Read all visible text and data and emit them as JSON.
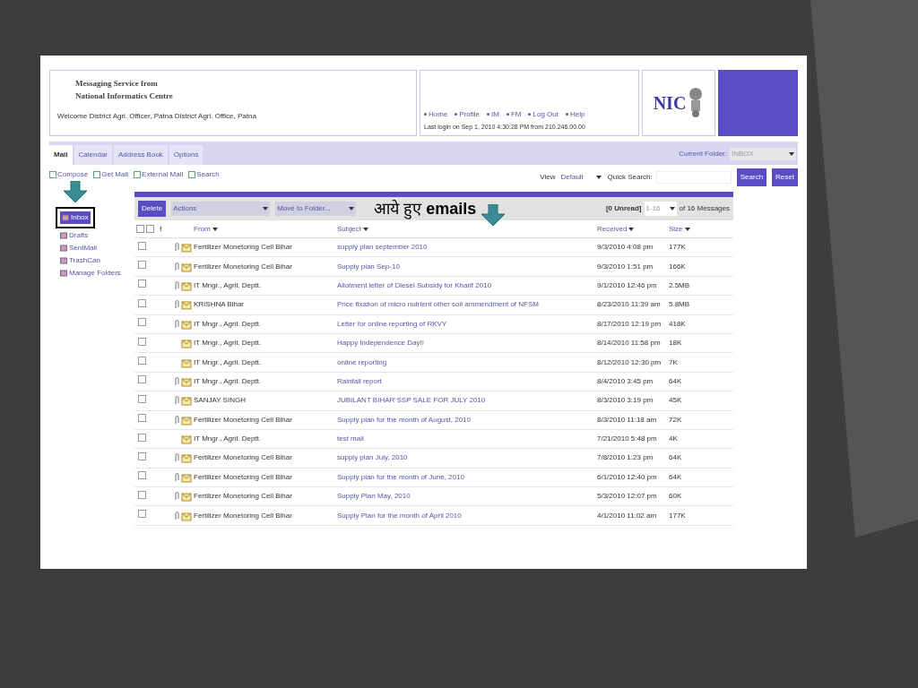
{
  "header": {
    "title_lines": [
      "Messaging Service from",
      "National Informatics Centre"
    ],
    "welcome": "Welcome District Agri. Officer, Patna District Agri. Office, Patna",
    "links": [
      "Home",
      "Profile",
      "IM",
      "FM",
      "Log Out",
      "Help"
    ],
    "last_login": "Last login on Sep 1, 2010 4:30:28 PM from 210.246.00.00",
    "logo": "NIC"
  },
  "tabs": [
    {
      "label": "Mail",
      "selected": true
    },
    {
      "label": "Calendar",
      "selected": false
    },
    {
      "label": "Address Book",
      "selected": false
    },
    {
      "label": "Options",
      "selected": false
    }
  ],
  "current_folder": {
    "label": "Current Folder:",
    "value": "INBOX"
  },
  "toolbar": [
    "Compose",
    "Get Mail",
    "External Mail",
    "Search"
  ],
  "view": {
    "label": "View",
    "value": "Default",
    "search_label": "Quick Search:",
    "buttons": [
      "Search",
      "Reset"
    ]
  },
  "folders": [
    {
      "label": "Inbox",
      "selected": true
    },
    {
      "label": "Drafts",
      "selected": false
    },
    {
      "label": "SentMail",
      "selected": false
    },
    {
      "label": "TrashCan",
      "selected": false
    },
    {
      "label": "Manage Folders",
      "selected": false
    }
  ],
  "actions": {
    "delete": "Delete",
    "actions": "Actions",
    "move": "Move to Folder...",
    "unread": "[0 Unread]",
    "range": "1-16",
    "total": "of 16 Messages"
  },
  "annotation": "आये हुए **emails**",
  "columns": [
    "!",
    "From",
    "Subject",
    "Received",
    "Size"
  ],
  "header_checkboxes": [
    {
      "checked": false
    },
    {
      "checked": false
    }
  ],
  "messages": [
    {
      "from": "Fertilizer Monetoring Cell Bihar",
      "subject": "supply plan september 2010",
      "received": "9/3/2010 4:08 pm",
      "size": "177K",
      "attachment": true,
      "checked": false
    },
    {
      "from": "Fertilizer Monetoring Cell Bihar",
      "subject": "Supply plan Sep-10",
      "received": "9/3/2010 1:51 pm",
      "size": "166K",
      "attachment": true,
      "checked": false
    },
    {
      "from": "IT Mngr., Agril. Deptt.",
      "subject": "Allotment letter of Diesel Subsidy for Kharif 2010",
      "received": "9/1/2010 12:46 pm",
      "size": "2.5MB",
      "attachment": true,
      "checked": false
    },
    {
      "from": "KRISHNA Bihar",
      "subject": "Price fixation of micro nutrient other soil ammendment of NFSM",
      "received": "8/23/2010 11:39 am",
      "size": "5.8MB",
      "attachment": true,
      "checked": false
    },
    {
      "from": "IT Mngr., Agril. Deptt.",
      "subject": "Letter for online reporting of RKVY",
      "received": "8/17/2010 12:19 pm",
      "size": "418K",
      "attachment": true,
      "checked": false
    },
    {
      "from": "IT Mngr., Agril. Deptt.",
      "subject": "Happy Independence Day!!",
      "received": "8/14/2010 11:58 pm",
      "size": "18K",
      "attachment": false,
      "checked": false
    },
    {
      "from": "IT Mngr., Agril. Deptt.",
      "subject": "online reporting",
      "received": "8/12/2010 12:30 pm",
      "size": "7K",
      "attachment": false,
      "checked": false
    },
    {
      "from": "IT Mngr., Agril. Deptt.",
      "subject": "Rainfall report",
      "received": "8/4/2010 3:45 pm",
      "size": "64K",
      "attachment": true,
      "checked": false
    },
    {
      "from": "SANJAY SINGH",
      "subject": "JUBILANT BIHAR SSP SALE FOR JULY 2010",
      "received": "8/3/2010 3:19 pm",
      "size": "45K",
      "attachment": true,
      "checked": false
    },
    {
      "from": "Fertilizer Monetoring Cell Bihar",
      "subject": "Supply plan for the month of August, 2010",
      "received": "8/3/2010 11:18 am",
      "size": "72K",
      "attachment": true,
      "checked": false
    },
    {
      "from": "IT Mngr., Agril. Deptt.",
      "subject": "test mail",
      "received": "7/21/2010 5:48 pm",
      "size": "4K",
      "attachment": false,
      "checked": false
    },
    {
      "from": "Fertilizer Monetoring Cell Bihar",
      "subject": "supply plan July, 2010",
      "received": "7/8/2010 1:23 pm",
      "size": "64K",
      "attachment": true,
      "checked": false
    },
    {
      "from": "Fertilizer Monetoring Cell Bihar",
      "subject": "Supply plan for the month of June, 2010",
      "received": "6/1/2010 12:40 pm",
      "size": "64K",
      "attachment": true,
      "checked": false
    },
    {
      "from": "Fertilizer Monetoring Cell Bihar",
      "subject": "Supply Plan May, 2010",
      "received": "5/3/2010 12:07 pm",
      "size": "60K",
      "attachment": true,
      "checked": false
    },
    {
      "from": "Fertilizer Monetoring Cell Bihar",
      "subject": "Supply Plan for the month of April 2010",
      "received": "4/1/2010 11:02 am",
      "size": "177K",
      "attachment": true,
      "checked": false
    }
  ]
}
